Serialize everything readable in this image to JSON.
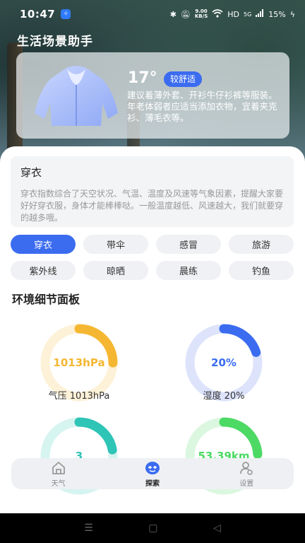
{
  "status_bar": {
    "time": "10:47",
    "network_speed_value": "9.00",
    "network_speed_unit": "KB/S",
    "network_type": "HD",
    "signal": "5G",
    "battery": "15%"
  },
  "page_title": "生活场景助手",
  "weather": {
    "temperature": "17°",
    "comfort": "较舒适",
    "advice": "建议着薄外套、开衫牛仔衫裤等服装。年老体弱者应适当添加衣物，宜着夹克衫、薄毛衣等。"
  },
  "info": {
    "title": "穿衣",
    "description": "穿衣指数综合了天空状况、气温、温度及风速等气象因素，提醒大家要好好穿衣服，身体才能棒棒哒。一般温度越低、风速越大，我们就要穿的越多哦。"
  },
  "chips": [
    {
      "label": "穿衣",
      "active": true
    },
    {
      "label": "带伞",
      "active": false
    },
    {
      "label": "感冒",
      "active": false
    },
    {
      "label": "旅游",
      "active": false
    },
    {
      "label": "紫外线",
      "active": false
    },
    {
      "label": "晾晒",
      "active": false
    },
    {
      "label": "晨练",
      "active": false
    },
    {
      "label": "钓鱼",
      "active": false
    }
  ],
  "section_title": "环境细节面板",
  "gauges": [
    {
      "value_text": "1013hPa",
      "label": "气压 1013hPa",
      "fraction": 0.25,
      "color": "#f5b731",
      "track": "#fdf1d8"
    },
    {
      "value_text": "20%",
      "label": "湿度 20%",
      "fraction": 0.2,
      "color": "#3b6cf0",
      "track": "#dde3fb"
    },
    {
      "value_text": "3",
      "label": "",
      "fraction": 0.22,
      "color": "#2ec4b6",
      "track": "#d6f4f0"
    },
    {
      "value_text": "53.39km",
      "label": "",
      "fraction": 0.24,
      "color": "#4cd964",
      "track": "#dcf7e0"
    }
  ],
  "tabs": [
    {
      "label": "天气",
      "icon": "house-icon",
      "active": false
    },
    {
      "label": "探索",
      "icon": "explore-face-icon",
      "active": true
    },
    {
      "label": "设置",
      "icon": "user-gear-icon",
      "active": false
    }
  ]
}
